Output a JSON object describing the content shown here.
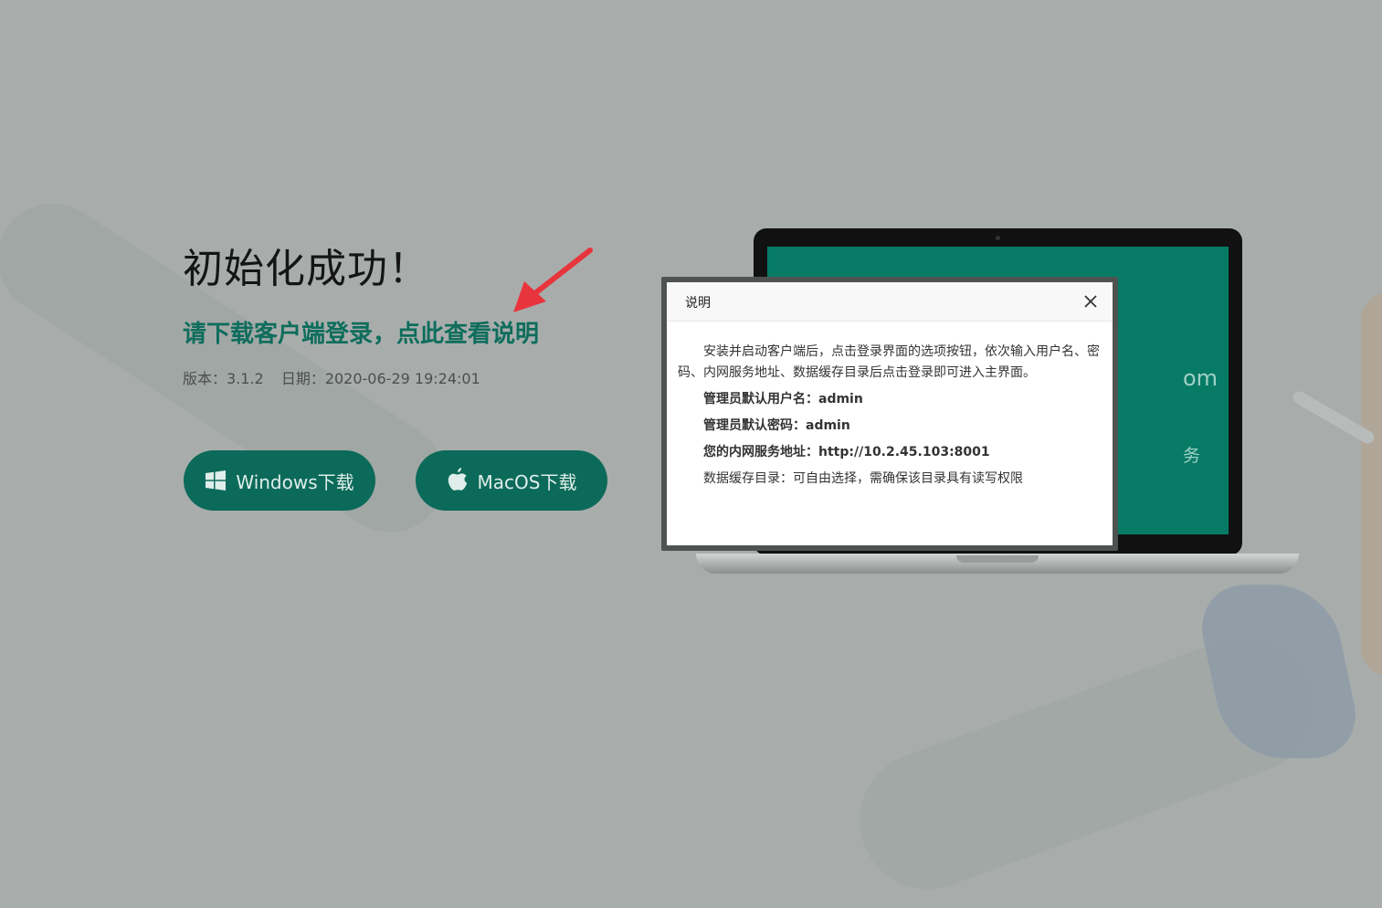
{
  "hero": {
    "title": "初始化成功！",
    "link": "请下载客户端登录，点此查看说明",
    "version": "版本：3.1.2",
    "date": "日期：2020-06-29 19:24:01"
  },
  "buttons": {
    "windows": "Windows下载",
    "mac": "MacOS下载"
  },
  "screen": {
    "text1": "om",
    "text2": "务"
  },
  "dialog": {
    "title": "说明",
    "intro": "安装并启动客户端后，点击登录界面的选项按钮，依次输入用户名、密码、内网服务地址、数据缓存目录后点击登录即可进入主界面。",
    "user": "管理员默认用户名：admin",
    "password": "管理员默认密码：admin",
    "server": "您的内网服务地址：http://10.2.45.103:8001",
    "cache": "数据缓存目录：可自由选择，需确保该目录具有读写权限"
  },
  "colors": {
    "accent": "#0c6a5a",
    "link": "#0e6d5c",
    "arrow": "#e8343c",
    "background": "#a8adac"
  },
  "icons": [
    "windows-icon",
    "apple-icon",
    "close-icon",
    "arrow-icon"
  ]
}
